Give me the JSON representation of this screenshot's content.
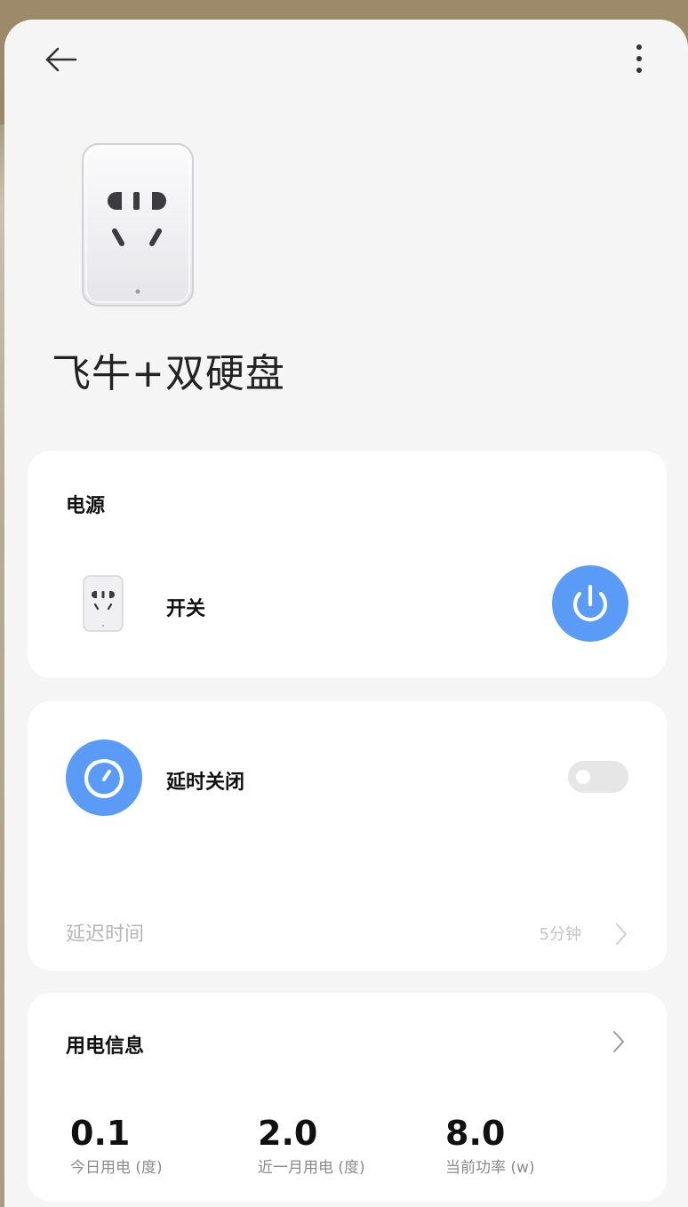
{
  "header": {
    "back_icon": "arrow-left-icon",
    "more_icon": "more-vertical-icon"
  },
  "device": {
    "name": "飞牛+双硬盘",
    "image": "smart-plug-image"
  },
  "power_card": {
    "title": "电源",
    "switch_label": "开关",
    "power_button_icon": "power-icon",
    "power_state": "on",
    "accent_color": "#5b9bf8"
  },
  "timer_card": {
    "title": "延时关闭",
    "timer_icon": "timer-icon",
    "toggle_state": "off",
    "delay_label": "延迟时间",
    "delay_value": "5分钟"
  },
  "energy_card": {
    "title": "用电信息",
    "stats": [
      {
        "value": "0.1",
        "label": "今日用电 (度)"
      },
      {
        "value": "2.0",
        "label": "近一月用电 (度)"
      },
      {
        "value": "8.0",
        "label": "当前功率 (w)"
      }
    ]
  }
}
